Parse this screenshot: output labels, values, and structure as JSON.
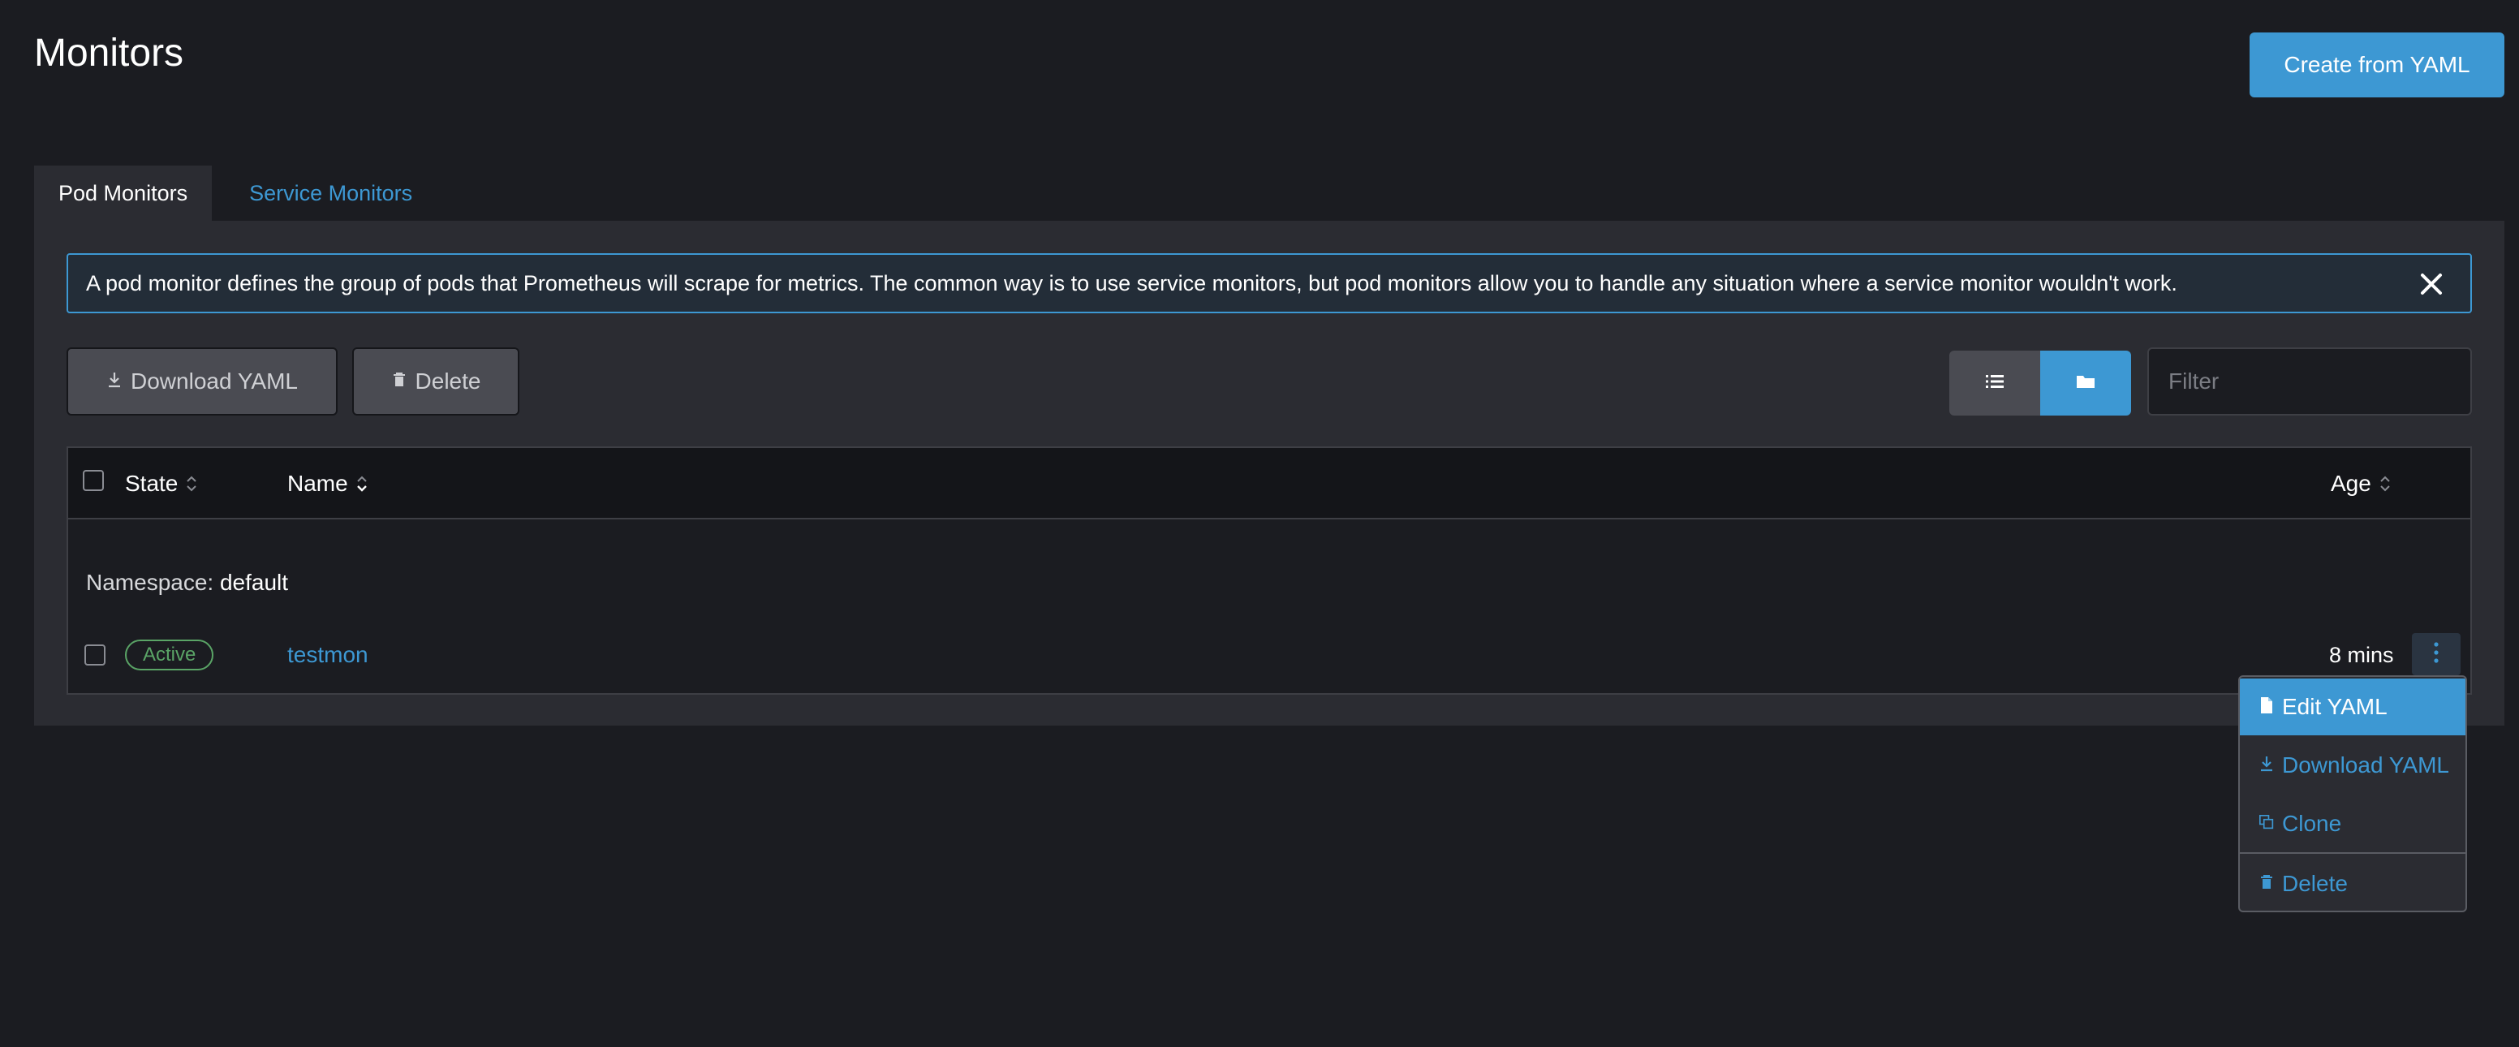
{
  "page": {
    "title": "Monitors"
  },
  "header": {
    "create_label": "Create from YAML"
  },
  "tabs": [
    {
      "label": "Pod Monitors",
      "active": true
    },
    {
      "label": "Service Monitors",
      "active": false
    }
  ],
  "banner": {
    "text": "A pod monitor defines the group of pods that Prometheus will scrape for metrics. The common way is to use service monitors, but pod monitors allow you to handle any situation where a service monitor wouldn't work."
  },
  "toolbar": {
    "download_label": "Download YAML",
    "delete_label": "Delete",
    "filter_placeholder": "Filter",
    "view_options": [
      "list-icon",
      "folder-icon"
    ],
    "active_view": "folder-icon"
  },
  "table": {
    "columns": [
      {
        "label": "State"
      },
      {
        "label": "Name"
      },
      {
        "label": "Age"
      }
    ],
    "groups": [
      {
        "label": "Namespace:",
        "value": "default",
        "rows": [
          {
            "state": "Active",
            "name": "testmon",
            "age": "8 mins"
          }
        ]
      }
    ]
  },
  "action_menu": {
    "items": [
      {
        "label": "Edit YAML",
        "icon": "file-icon",
        "highlighted": true
      },
      {
        "label": "Download YAML",
        "icon": "download-icon",
        "highlighted": false
      },
      {
        "label": "Clone",
        "icon": "copy-icon",
        "highlighted": false
      },
      {
        "label": "Delete",
        "icon": "trash-icon",
        "highlighted": false
      }
    ]
  },
  "colors": {
    "accent": "#3d98d3",
    "background": "#1b1c21",
    "panel": "#2b2c32",
    "success": "#5aa466"
  }
}
